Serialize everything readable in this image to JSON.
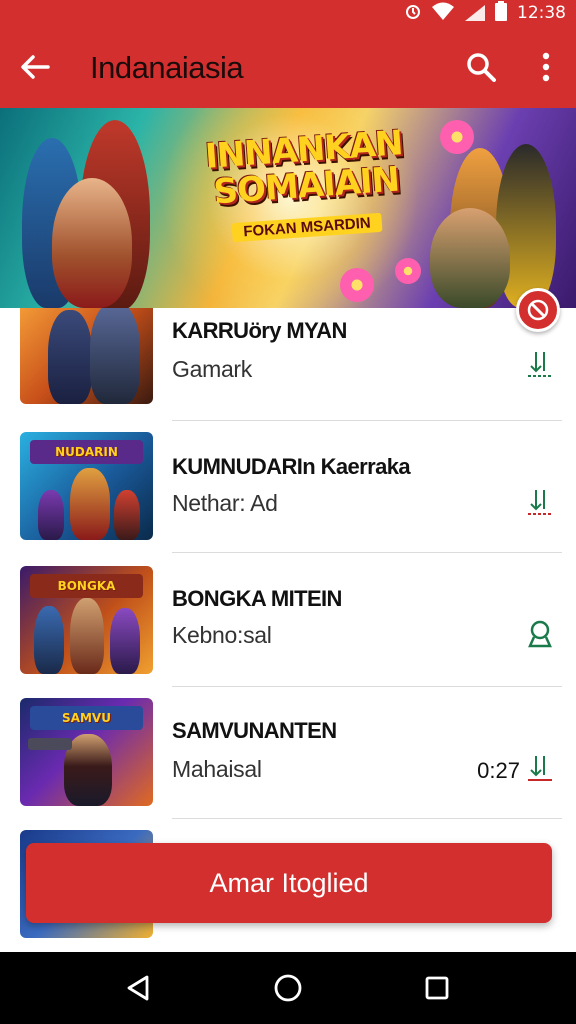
{
  "status_bar": {
    "time": "12:38"
  },
  "app_bar": {
    "title": "Indanaiasia"
  },
  "banner": {
    "title": "INNANKAN SOMAIAIN",
    "subtitle": "FOKAN MSARDIN"
  },
  "list": {
    "items": [
      {
        "title": "KARRUöry MYAN",
        "subtitle": "Gamark",
        "meta": ""
      },
      {
        "title": "KUMNUDARIn Kaerraka",
        "subtitle": "Nethar: Ad",
        "meta": ""
      },
      {
        "title": "BONGKA MITEIN",
        "subtitle": "Kebno:sal",
        "meta": ""
      },
      {
        "title": "SAMVUNANTEN",
        "subtitle": "Mahaisal",
        "meta": "0:27"
      }
    ]
  },
  "cta": {
    "label": "Amar Itoglied"
  },
  "colors": {
    "primary": "#d32f2f",
    "accent_green": "#1b7a4a",
    "nav": "#000000"
  },
  "icons": {
    "status": [
      "alarm-icon",
      "wifi-icon",
      "signal-icon",
      "battery-icon"
    ],
    "app_bar": [
      "back-arrow-icon",
      "search-icon",
      "more-vert-icon"
    ],
    "rows": [
      "download-icon",
      "download-icon",
      "location-pin-icon",
      "download-icon"
    ],
    "nav": [
      "nav-back-icon",
      "nav-home-icon",
      "nav-recents-icon"
    ]
  }
}
